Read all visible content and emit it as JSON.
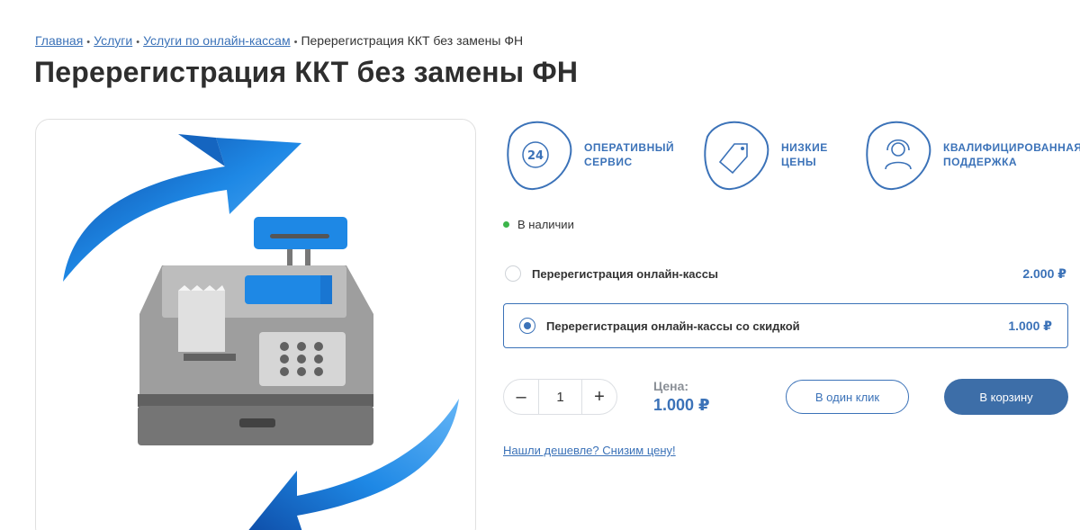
{
  "breadcrumb": {
    "items": [
      {
        "label": "Главная"
      },
      {
        "label": "Услуги"
      },
      {
        "label": "Услуги по онлайн-кассам"
      }
    ],
    "current": "Перерегистрация ККТ без замены ФН",
    "separator": "•"
  },
  "page_title": "Перерегистрация ККТ без замены ФН",
  "features": [
    {
      "icon": "clock-24-icon",
      "label": "Оперативный\nсервис"
    },
    {
      "icon": "price-tag-icon",
      "label": "Низкие\nцены"
    },
    {
      "icon": "headset-support-icon",
      "label": "Квалифицированная\nподдержка"
    }
  ],
  "stock": {
    "label": "В наличии",
    "color": "#3cb54a"
  },
  "options": [
    {
      "name": "Перерегистрация онлайн-кассы",
      "price": "2.000 ₽",
      "selected": false
    },
    {
      "name": "Перерегистрация онлайн-кассы со скидкой",
      "price": "1.000 ₽",
      "selected": true
    }
  ],
  "quantity": {
    "minus": "–",
    "value": "1",
    "plus": "+"
  },
  "price": {
    "label": "Цена:",
    "value": "1.000 ₽"
  },
  "buttons": {
    "one_click": "В один клик",
    "cart": "В корзину"
  },
  "cheaper_link": "Нашли дешевле? Снизим цену!",
  "colors": {
    "accent": "#3b72b8",
    "button_fill": "#3d6ea8",
    "arrow": "#1e88e5"
  }
}
